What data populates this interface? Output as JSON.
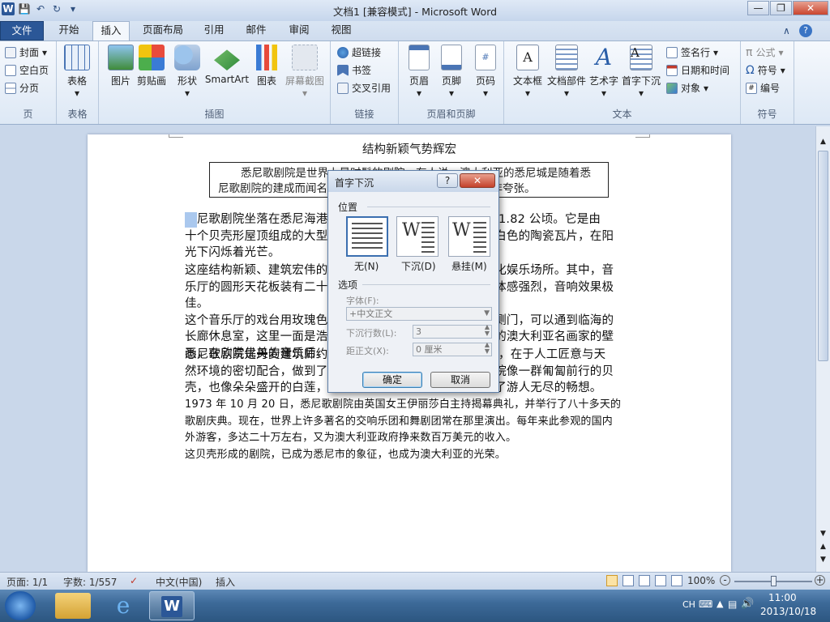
{
  "window": {
    "title": "文档1 [兼容模式] - Microsoft Word"
  },
  "tabs": [
    "文件",
    "开始",
    "插入",
    "页面布局",
    "引用",
    "邮件",
    "审阅",
    "视图"
  ],
  "ribbon": {
    "page_group": {
      "label": "页",
      "items": [
        "封面",
        "空白页",
        "分页"
      ]
    },
    "table_group": {
      "label": "表格",
      "items": [
        "表格"
      ]
    },
    "illustrations_group": {
      "label": "插图",
      "items": [
        "图片",
        "剪贴画",
        "形状",
        "SmartArt",
        "图表",
        "屏幕截图"
      ]
    },
    "links_group": {
      "label": "链接",
      "items": [
        "超链接",
        "书签",
        "交叉引用"
      ]
    },
    "header_footer_group": {
      "label": "页眉和页脚",
      "items": [
        "页眉",
        "页脚",
        "页码"
      ]
    },
    "text_group": {
      "label": "文本",
      "items": [
        "文本框",
        "文档部件",
        "艺术字",
        "首字下沉"
      ],
      "small_items": [
        "签名行",
        "日期和时间",
        "对象"
      ]
    },
    "symbols_group": {
      "label": "符号",
      "items": [
        "公式",
        "符号",
        "编号"
      ]
    }
  },
  "document": {
    "heading": "结构新颖气势辉宏",
    "box_line1": "悉尼歌剧院是世界上最时髦的剧院，有人说，澳大利亚的悉尼城是随着悉",
    "box_line2": "尼歌剧院的建成而闻名于世，而且为世人所认识，此话并非夸张。",
    "p1": [
      "悉尼歌剧院坐落在悉尼海港的便利朗角上，三面环海，占地 1.82 公顷。它是由",
      "十个贝壳形屋顶组成的大型建筑，屋顶上镶嵌着一百多万块白色的陶瓷瓦片，在阳",
      "光下闪烁着光芒。"
    ],
    "p2": [
      "这座结构新颖、建筑宏伟的剧院，是一座规模宏大的综合文化娱乐场所。其中，音",
      "乐厅的圆形天花板装有二十一个有机玻璃圆盘，使声音的立体感强烈，音响效果极佳。",
      "这个音乐厅的戏台用玫瑰色的花岗岩砌成，十分华丽。推开侧门，可以通到临海的",
      "长廊休息室，这里一面是浩渺的大海，一面是许多挂满著名的澳大利亚名画家的壁",
      "画，在欣赏优美的音乐后，又可以在这里凭栏远眺。"
    ],
    "p3": [
      "悉尼歌剧院是丹麦建筑师约恩·乌松设计的。他的设计的成功，在于人工匠意与天",
      "然环境的密切配合，做到了天衣无缝，远远望去，悉尼歌剧院像一群匍匐前行的贝",
      "壳，也像朵朵盛开的白莲，又像鼓满风帆待航的船队，引起了游人无尽的畅想。"
    ],
    "p4": [
      "1973 年 10 月 20 日，悉尼歌剧院由英国女王伊丽莎白主持揭幕典礼，并举行了八十多天的",
      "歌剧庆典。现在，世界上许多著名的交响乐团和舞剧团常在那里演出。每年来此参观的国内",
      "外游客，多达二十万左右，又为澳大利亚政府挣来数百万美元的收入。"
    ],
    "p5": [
      "这贝壳形成的剧院，已成为悉尼市的象征，也成为澳大利亚的光荣。"
    ]
  },
  "dialog": {
    "title": "首字下沉",
    "position_label": "位置",
    "options": [
      {
        "label": "无(N)",
        "selected": true
      },
      {
        "label": "下沉(D)",
        "selected": false
      },
      {
        "label": "悬挂(M)",
        "selected": false
      }
    ],
    "options_label": "选项",
    "font_label": "字体(F):",
    "font_value": "+中文正文",
    "lines_label": "下沉行数(L):",
    "lines_value": "3",
    "distance_label": "距正文(X):",
    "distance_value": "0 厘米",
    "ok": "确定",
    "cancel": "取消"
  },
  "status": {
    "page": "页面: 1/1",
    "words": "字数: 1/557",
    "language": "中文(中国)",
    "mode": "插入",
    "zoom": "100%"
  },
  "taskbar": {
    "lang": "CH",
    "time": "11:00",
    "date": "2013/10/18"
  }
}
